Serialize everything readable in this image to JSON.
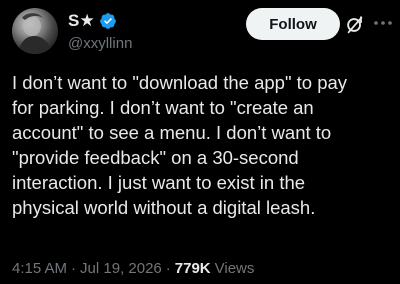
{
  "author": {
    "display_name": "S★",
    "handle": "@xxyllinn",
    "verified": true,
    "avatar_icon": "avatar-photo",
    "verified_color": "#1d9bf0"
  },
  "actions": {
    "follow_label": "Follow",
    "grok_icon": "grok-icon",
    "more_icon": "more-icon"
  },
  "tweet": {
    "text": "I don’t want to \"download the app\" to pay\nfor parking. I don’t want to \"create an\naccount\" to see a menu. I don’t want to\n\"provide feedback\" on a 30-second\ninteraction. I just want to exist in the\nphysical world without a digital leash."
  },
  "meta": {
    "time": "4:15 AM",
    "separator": "·",
    "date": "Jul 19, 2026",
    "views_count": "779K",
    "views_label": "Views"
  },
  "colors": {
    "background": "#000000",
    "text_primary": "#e7e9ea",
    "text_secondary": "#71767b",
    "follow_bg": "#eff3f4",
    "follow_text": "#0f1419"
  }
}
